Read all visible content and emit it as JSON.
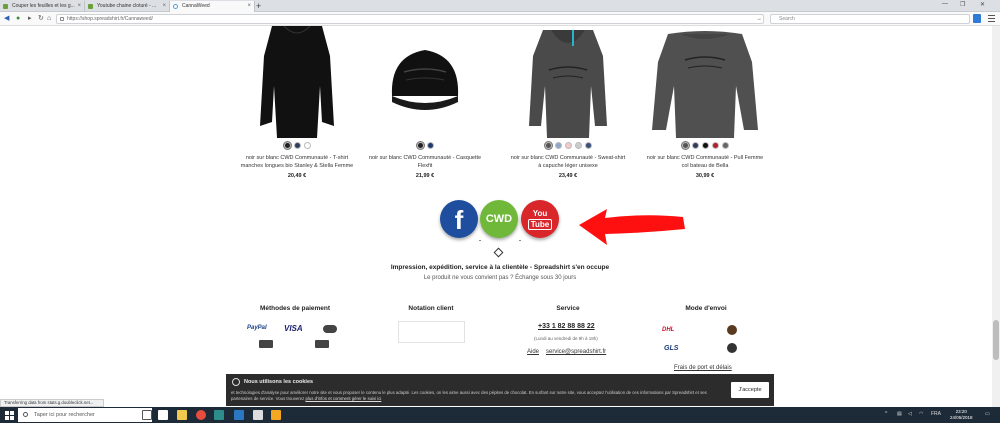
{
  "browser": {
    "tabs": [
      {
        "label": "Couper les feuilles et les g..."
      },
      {
        "label": "Youtube chaine cloturé - ..."
      },
      {
        "label": "CannaWeed"
      }
    ],
    "url": "https://shop.spreadshirt.fr/Cannaweed/",
    "search_placeholder": "Search",
    "status_text": "Transferring data from stats.g.doubleclick.net..."
  },
  "products": [
    {
      "name": "noir sur blanc CWD Communauté - T-shirt manches longues bio Stanley & Stella Femme",
      "price": "20,49 €",
      "swatches": [
        "#222222",
        "#2e3d5e",
        "#ffffff"
      ]
    },
    {
      "name": "noir sur blanc CWD Communauté - Casquette Flexfit",
      "price": "21,99 €",
      "swatches": [
        "#222222",
        "#1f3b6b"
      ]
    },
    {
      "name": "noir sur blanc CWD Communauté - Sweat-shirt à capuche léger unisexe",
      "price": "23,49 €",
      "swatches": [
        "#555555",
        "#8da8c8",
        "#f4c9cc",
        "#cccccc",
        "#3b4f7a"
      ]
    },
    {
      "name": "noir sur blanc CWD Communauté - Pull Femme col bateau de Bella",
      "price": "30,99 €",
      "swatches": [
        "#555555",
        "#2e3d5e",
        "#111111",
        "#b22030",
        "#666666"
      ]
    }
  ],
  "social": {
    "facebook": "f",
    "cwd": "CWD",
    "youtube_top": "You",
    "youtube_bottom": "Tube"
  },
  "service": {
    "title": "Impression, expédition, service à la clientèle - Spreadshirt s'en occupe",
    "subtitle": "Le produit ne vous convient pas ? Échange sous 30 jours"
  },
  "footer": {
    "payment_title": "Méthodes de paiement",
    "payment_logos": [
      "PayPal",
      "VISA"
    ],
    "rating_title": "Notation client",
    "service_title": "Service",
    "phone": "+33 1 82 88 88 22",
    "hours": "(Lundi au vendredi de 9h à 18h)",
    "help_link": "Aide",
    "email_link": "service@spreadshirt.fr",
    "shipping_title": "Mode d'envoi",
    "shipping_logos": [
      "DHL",
      "GLS"
    ],
    "shipping_costs_link": "Frais de port et délais"
  },
  "cookie": {
    "title": "Nous utilisons les cookies",
    "text": "et technologies d'analyse pour améliorer notre site et vous proposer le contenu le plus adapté. Les cookies, on les aime aussi avec des pépites de chocolat. En surfant sur notre site, vous acceptez l'utilisation de ces informations par Spreadshirt et ses partenaires de service. Vous trouverez",
    "link": "plus d'infos et comment gérer le suivi ici",
    "accept": "J'accepte"
  },
  "taskbar": {
    "search_placeholder": "Taper ici pour rechercher",
    "language": "FRA",
    "time": "23:20",
    "date": "24/05/2018"
  }
}
